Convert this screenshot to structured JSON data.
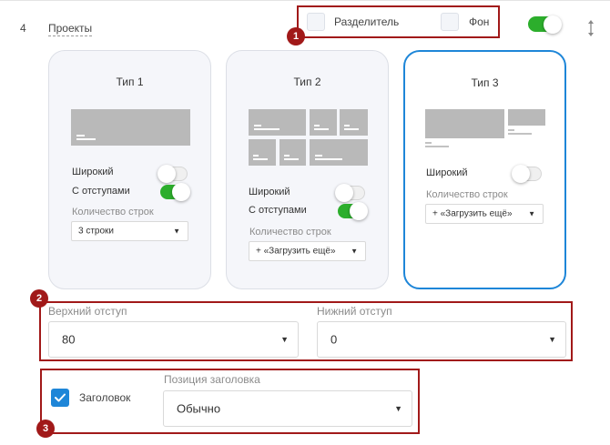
{
  "section": {
    "number": "4",
    "title": "Проекты",
    "enabled": true
  },
  "options": {
    "divider_label": "Разделитель",
    "background_label": "Фон"
  },
  "cards": [
    {
      "title": "Тип 1",
      "wide_label": "Широкий",
      "wide_on": false,
      "padding_label": "С отступами",
      "padding_on": true,
      "rows_label": "Количество строк",
      "rows_value": "3 строки"
    },
    {
      "title": "Тип 2",
      "wide_label": "Широкий",
      "wide_on": false,
      "padding_label": "С отступами",
      "padding_on": true,
      "rows_label": "Количество строк",
      "rows_value": "+ «Загрузить ещё»"
    },
    {
      "title": "Тип 3",
      "wide_label": "Широкий",
      "wide_on": false,
      "rows_label": "Количество строк",
      "rows_value": "+ «Загрузить ещё»",
      "selected": true
    }
  ],
  "spacing": {
    "top_label": "Верхний отступ",
    "top_value": "80",
    "bottom_label": "Нижний отступ",
    "bottom_value": "0"
  },
  "heading": {
    "checkbox_label": "Заголовок",
    "checked": true,
    "position_label": "Позиция заголовка",
    "position_value": "Обычно"
  },
  "annotations": [
    "1",
    "2",
    "3"
  ],
  "colors": {
    "accent_blue": "#1e86d8",
    "toggle_green": "#2cae2c",
    "annotation_red": "#a11919"
  }
}
